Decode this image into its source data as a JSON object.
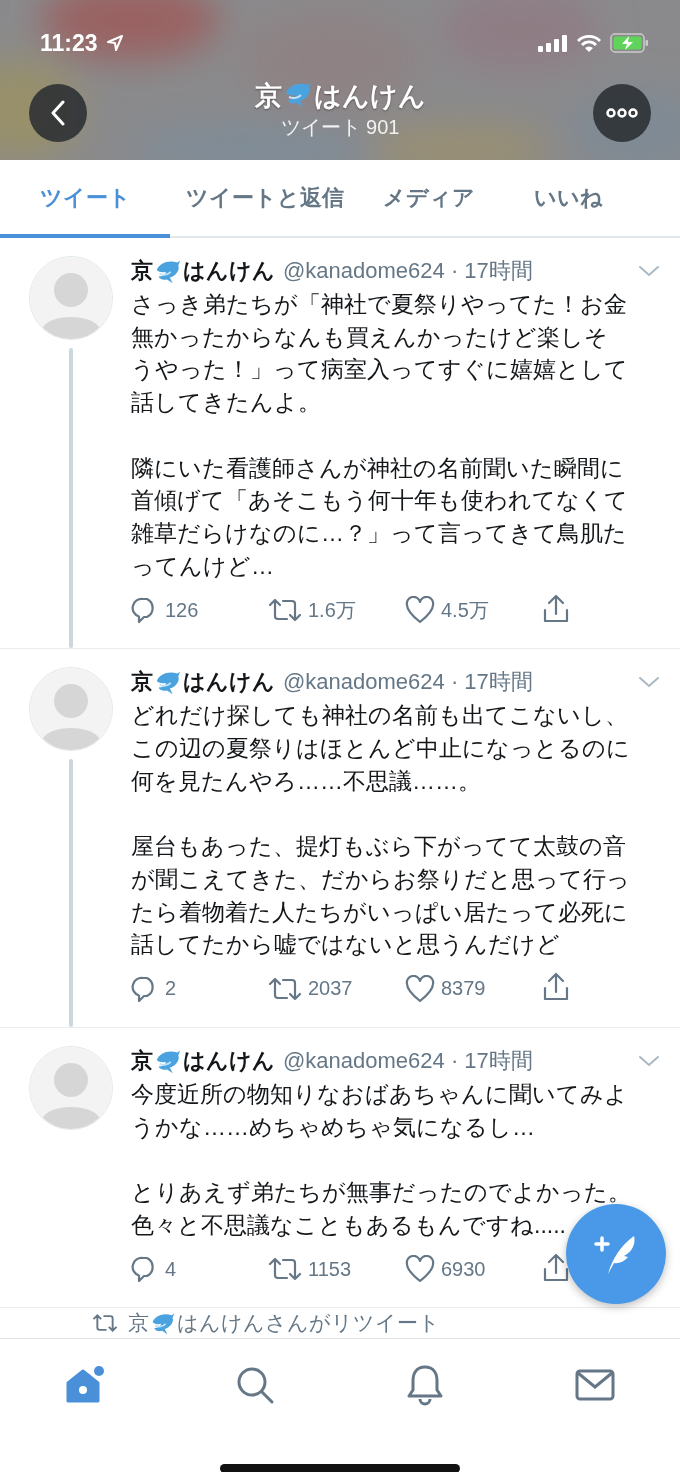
{
  "status_bar": {
    "time": "11:23"
  },
  "header": {
    "name": [
      "京",
      "はんけん"
    ],
    "subtitle": "ツイート 901"
  },
  "tabs": [
    {
      "label": "ツイート",
      "selected": true
    },
    {
      "label": "ツイートと返信",
      "selected": false
    },
    {
      "label": "メディア",
      "selected": false
    },
    {
      "label": "いいね",
      "selected": false
    }
  ],
  "tweets": [
    {
      "name": [
        "京",
        "はんけん"
      ],
      "meta": "@kanadome624 · 17時間",
      "connected": true,
      "paragraphs": [
        "さっき弟たちが「神社で夏祭りやってた！お金無かったからなんも買えんかったけど楽しそうやった！」って病室入ってすぐに嬉嬉として話してきたんよ。",
        "隣にいた看護師さんが神社の名前聞いた瞬間に首傾げて「あそこもう何十年も使われてなくて雑草だらけなのに…？」って言ってきて鳥肌たってんけど…"
      ],
      "replies": "126",
      "retweets": "1.6万",
      "likes": "4.5万"
    },
    {
      "name": [
        "京",
        "はんけん"
      ],
      "meta": "@kanadome624 · 17時間",
      "connected": true,
      "paragraphs": [
        "どれだけ探しても神社の名前も出てこないし、この辺の夏祭りはほとんど中止になっとるのに何を見たんやろ……不思議……。",
        "屋台もあった、提灯もぶら下がってて太鼓の音が聞こえてきた、だからお祭りだと思って行ったら着物着た人たちがいっぱい居たって必死に話してたから嘘ではないと思うんだけど"
      ],
      "replies": "2",
      "retweets": "2037",
      "likes": "8379"
    },
    {
      "name": [
        "京",
        "はんけん"
      ],
      "meta": "@kanadome624 · 17時間",
      "connected": false,
      "paragraphs": [
        "今度近所の物知りなおばあちゃんに聞いてみようかな……めちゃめちゃ気になるし…",
        "とりあえず弟たちが無事だったのでよかった。色々と不思議なこともあるもんですね....."
      ],
      "replies": "4",
      "retweets": "1153",
      "likes": "6930"
    }
  ],
  "retweet_notice": {
    "name": [
      "京",
      "はんけんさんがリツイート"
    ]
  },
  "tab_bar": [
    {
      "kind": "home",
      "selected": true
    },
    {
      "kind": "search",
      "selected": false
    },
    {
      "kind": "notifications",
      "selected": false
    },
    {
      "kind": "messages",
      "selected": false
    }
  ]
}
